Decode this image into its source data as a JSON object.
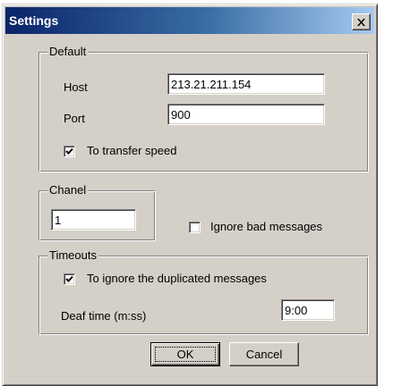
{
  "window": {
    "title": "Settings",
    "close_icon": "close-icon"
  },
  "default_group": {
    "legend": "Default",
    "host_label": "Host",
    "host_value": "213.21.211.154",
    "port_label": "Port",
    "port_value": "900",
    "transfer_speed_label": "To transfer speed",
    "transfer_speed_checked": true
  },
  "chanel_group": {
    "legend": "Chanel",
    "chanel_value": "1"
  },
  "ignore_bad": {
    "label": "Ignore bad messages",
    "checked": false
  },
  "timeouts_group": {
    "legend": "Timeouts",
    "ignore_duplicated_label": "To ignore the duplicated messages",
    "ignore_duplicated_checked": true,
    "deaf_time_label": "Deaf time (m:ss)",
    "deaf_time_value": "9:00"
  },
  "buttons": {
    "ok_label": "OK",
    "cancel_label": "Cancel"
  },
  "colors": {
    "title_gradient_start": "#0a246a",
    "title_gradient_end": "#a6caf0",
    "dialog_face": "#d4d0c8"
  }
}
